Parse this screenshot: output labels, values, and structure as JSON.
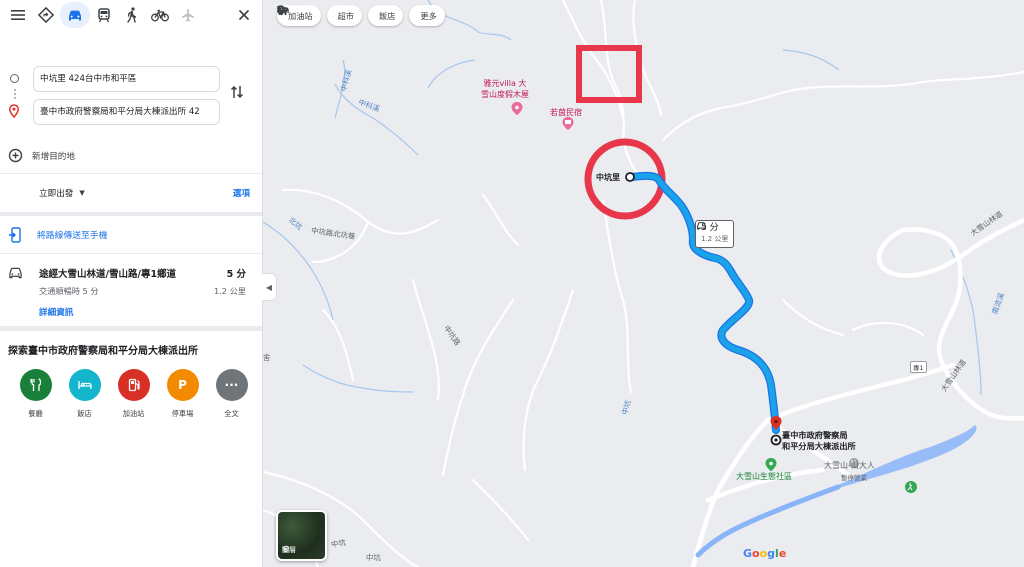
{
  "travel_modes": {
    "menu_icon": "menu-icon",
    "best_icon": "best-route-icon",
    "car_icon": "car-icon",
    "transit_icon": "transit-icon",
    "walk_icon": "walk-icon",
    "bike_icon": "bike-icon",
    "flight_icon": "flight-icon",
    "close_icon": "close-icon",
    "active": "car"
  },
  "directions": {
    "origin": "中坑里 424台中市和平區",
    "destination": "臺中市政府警察局和平分局大棟派出所 42",
    "add_destination": "新增目的地",
    "depart_now": "立即出發",
    "options": "選項"
  },
  "send_to_phone": "將路線傳送至手機",
  "route": {
    "title": "途經大雪山林道/雪山路/專1鄉道",
    "duration": "5 分",
    "traffic": "交通順暢時 5 分",
    "distance": "1.2 公里",
    "details": "詳細資訊"
  },
  "explore": {
    "title": "探索臺中市政府警察局和平分局大棟派出所",
    "items": [
      {
        "label": "餐廳",
        "color": "#188038",
        "icon": "restaurant-icon"
      },
      {
        "label": "飯店",
        "color": "#12b5cb",
        "icon": "hotel-icon"
      },
      {
        "label": "加油站",
        "color": "#d93025",
        "icon": "gas-station-icon"
      },
      {
        "label": "停車場",
        "color": "#f28b00",
        "icon": "parking-icon"
      },
      {
        "label": "全文",
        "color": "#70757a",
        "icon": "more-icon"
      }
    ]
  },
  "map": {
    "chips": [
      "加油站",
      "超市",
      "飯店",
      "更多"
    ],
    "labels": {
      "yayuan": "雅元villa 大\n雪山度假木屋",
      "ruoyin": "若茵民宿",
      "zhongkeng_xi_a": "中科溪",
      "zhongkeng_xi_b": "中科溪",
      "origin_label": "中坑里",
      "beikeng": "北坑",
      "beikeng_lane": "中坑路北坑巷",
      "she": "舍",
      "zhongkeng_road": "中坑路",
      "zhongkeng_b": "中坑",
      "zhongkeng_c": "中坑",
      "zhongkeng_d": "中坑",
      "dasue_forest_road_a": "大雪山林道",
      "dasue_forest_road_b": "大雪山林道",
      "nanshi_xi": "南流溪",
      "road_shield": "專1",
      "dest_label": "臺中市政府警察局\n和平分局大棟派出所",
      "eco_area": "大雪山生態社區",
      "camp": "大雪山-山大人",
      "camp_status": "暫停營業"
    },
    "route_badge": {
      "duration": "5 分",
      "distance": "1.2 公里"
    },
    "layers_label": "圖層",
    "google_logo": "Google",
    "colors": {
      "route": "#1aa3e8",
      "route_outline": "#1a73e8",
      "annotation": "#e8364b",
      "water": "#a7c6ee",
      "lake": "#8ab4f8"
    }
  }
}
